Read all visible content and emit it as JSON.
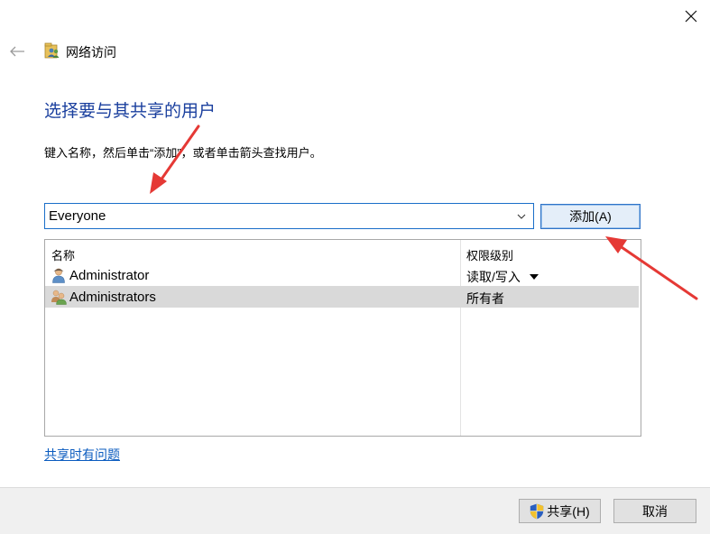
{
  "window": {
    "title": "网络访问",
    "title_icon": "network-users-icon",
    "close_icon": "close-icon",
    "back_icon": "back-arrow-icon"
  },
  "main": {
    "heading": "选择要与其共享的用户",
    "instruction": "键入名称，然后单击“添加”，或者单击箭头查找用户。",
    "user_input": {
      "value": "Everyone",
      "placeholder": ""
    },
    "add_button_label": "添加(A)"
  },
  "users_table": {
    "columns": [
      "名称",
      "权限级别"
    ],
    "rows": [
      {
        "name": "Administrator",
        "permission": "读取/写入",
        "icon": "user-icon",
        "selected": false
      },
      {
        "name": "Administrators",
        "permission": "所有者",
        "icon": "user-group-icon",
        "selected": true
      }
    ]
  },
  "help_link": "共享时有问题",
  "footer": {
    "share_button_label": "共享(H)",
    "share_icon": "uac-shield-icon",
    "cancel_button_label": "取消"
  },
  "colors": {
    "heading": "#1a3f9e",
    "link": "#0a5bbf",
    "annotation_arrow": "#e53935",
    "focus_border": "#1a6ec9",
    "selected_row": "#d9d9d9"
  }
}
